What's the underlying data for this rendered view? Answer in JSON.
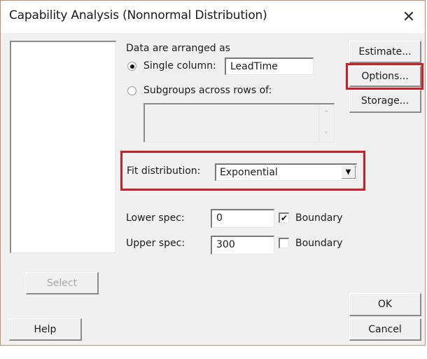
{
  "window": {
    "title": "Capability Analysis (Nonnormal Distribution)",
    "close_icon": "close-icon"
  },
  "variables_list": {
    "items": []
  },
  "data_arrangement": {
    "heading": "Data are arranged as",
    "single_column": {
      "label": "Single column:",
      "selected": true,
      "value": "LeadTime"
    },
    "subgroups": {
      "label": "Subgroups across rows of:",
      "selected": false,
      "value": ""
    }
  },
  "fit_distribution": {
    "label": "Fit distribution:",
    "selected": "Exponential",
    "highlighted": true
  },
  "specs": {
    "lower": {
      "label": "Lower spec:",
      "value": "0",
      "boundary_label": "Boundary",
      "boundary_checked": true
    },
    "upper": {
      "label": "Upper spec:",
      "value": "300",
      "boundary_label": "Boundary",
      "boundary_checked": false
    }
  },
  "buttons": {
    "estimate": "Estimate...",
    "options": "Options...",
    "storage": "Storage...",
    "select": "Select",
    "help": "Help",
    "ok": "OK",
    "cancel": "Cancel"
  },
  "colors": {
    "highlight": "#cc1f27",
    "dialog_bg": "#f0f0f0",
    "window_border": "#c98a6a"
  }
}
